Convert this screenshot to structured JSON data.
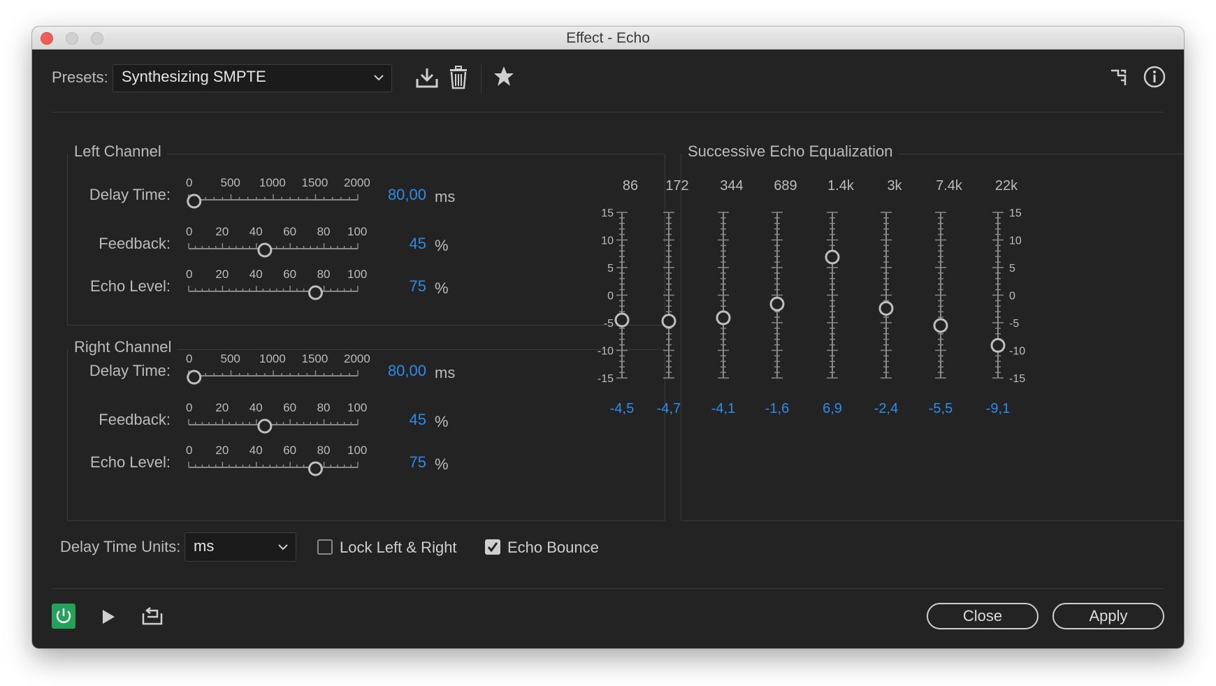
{
  "window": {
    "title": "Effect - Echo"
  },
  "presets": {
    "label": "Presets:",
    "selected": "Synthesizing SMPTE"
  },
  "left_channel": {
    "title": "Left Channel",
    "delay": {
      "label": "Delay Time:",
      "value": "80,00",
      "unit": "ms",
      "ticks": [
        "0",
        "500",
        "1000",
        "1500",
        "2000"
      ],
      "fraction": 0.032
    },
    "feedback": {
      "label": "Feedback:",
      "value": "45",
      "unit": "%",
      "ticks": [
        "0",
        "20",
        "40",
        "60",
        "80",
        "100"
      ],
      "fraction": 0.45
    },
    "echo_level": {
      "label": "Echo Level:",
      "value": "75",
      "unit": "%",
      "ticks": [
        "0",
        "20",
        "40",
        "60",
        "80",
        "100"
      ],
      "fraction": 0.75
    }
  },
  "right_channel": {
    "title": "Right Channel",
    "delay": {
      "label": "Delay Time:",
      "value": "80,00",
      "unit": "ms",
      "ticks": [
        "0",
        "500",
        "1000",
        "1500",
        "2000"
      ],
      "fraction": 0.032
    },
    "feedback": {
      "label": "Feedback:",
      "value": "45",
      "unit": "%",
      "ticks": [
        "0",
        "20",
        "40",
        "60",
        "80",
        "100"
      ],
      "fraction": 0.45
    },
    "echo_level": {
      "label": "Echo Level:",
      "value": "75",
      "unit": "%",
      "ticks": [
        "0",
        "20",
        "40",
        "60",
        "80",
        "100"
      ],
      "fraction": 0.75
    }
  },
  "eq": {
    "title": "Successive Echo Equalization",
    "scale_labels": [
      "15",
      "10",
      "5",
      "0",
      "-5",
      "-10",
      "-15"
    ],
    "range": [
      -15,
      15
    ],
    "bands": [
      {
        "freq": "86",
        "value": -4.5,
        "display": "-4,5"
      },
      {
        "freq": "172",
        "value": -4.7,
        "display": "-4,7"
      },
      {
        "freq": "344",
        "value": -4.1,
        "display": "-4,1"
      },
      {
        "freq": "689",
        "value": -1.6,
        "display": "-1,6"
      },
      {
        "freq": "1.4k",
        "value": 6.9,
        "display": "6,9"
      },
      {
        "freq": "3k",
        "value": -2.4,
        "display": "-2,4"
      },
      {
        "freq": "7.4k",
        "value": -5.5,
        "display": "-5,5"
      },
      {
        "freq": "22k",
        "value": -9.1,
        "display": "-9,1"
      }
    ]
  },
  "delay_units": {
    "label": "Delay Time Units:",
    "selected": "ms"
  },
  "lock": {
    "label": "Lock Left & Right",
    "checked": false
  },
  "echo_bounce": {
    "label": "Echo Bounce",
    "checked": true
  },
  "buttons": {
    "close": "Close",
    "apply": "Apply"
  },
  "icons": {
    "save": "save-preset-icon",
    "delete": "trash-icon",
    "favorite": "star-icon",
    "routing": "channel-routing-icon",
    "info": "info-icon",
    "power": "power-icon",
    "play": "play-icon",
    "loop": "loop-playback-icon"
  },
  "colors": {
    "accent_blue": "#2d8ceb",
    "power_green": "#26a15a",
    "background": "#232323"
  }
}
